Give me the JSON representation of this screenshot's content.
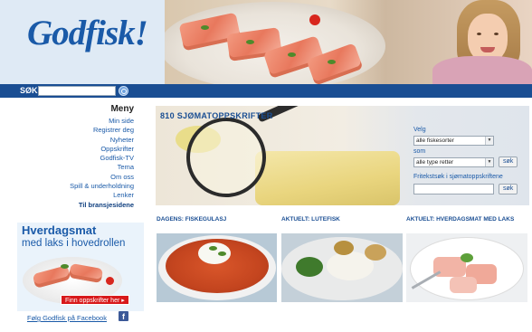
{
  "header": {
    "logo": "Godfisk!"
  },
  "search": {
    "label": "SØK",
    "placeholder": "",
    "value": ""
  },
  "sidebar": {
    "menu_title": "Meny",
    "items": [
      {
        "label": "Min side"
      },
      {
        "label": "Registrer deg"
      },
      {
        "label": "Nyheter"
      },
      {
        "label": "Oppskrifter"
      },
      {
        "label": "Godfisk-TV"
      },
      {
        "label": "Tema"
      },
      {
        "label": "Om oss"
      },
      {
        "label": "Spill & underholdning"
      },
      {
        "label": "Lenker"
      },
      {
        "label": "Til bransjesidene"
      }
    ],
    "promo": {
      "title": "Hverdagsmat",
      "subtitle": "med laks i hovedrollen",
      "button": "Finn oppskrifter her ▸"
    },
    "facebook_link": "Følg Godfisk på Facebook",
    "facebook_icon": "f"
  },
  "banner": {
    "title": "810 SJØMATOPPSKRIFTER",
    "velg_label": "Velg",
    "fish_select": "alle fiskesorter",
    "som_label": "som",
    "dish_select": "alle type retter",
    "sok_button": "søk",
    "freetext_label": "Fritekstsøk i sjømatoppskriftene",
    "freetext_value": "",
    "sok_button2": "søk"
  },
  "cards": [
    {
      "title": "DAGENS: FISKEGULASJ"
    },
    {
      "title": "AKTUELT: LUTEFISK"
    },
    {
      "title": "AKTUELT: HVERDAGSMAT MED LAKS"
    }
  ]
}
